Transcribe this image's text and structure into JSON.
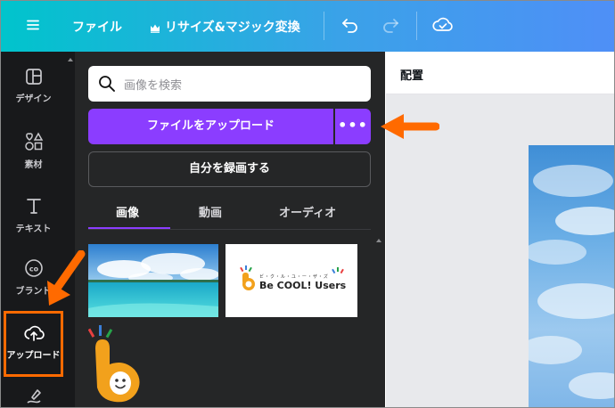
{
  "topbar": {
    "file_label": "ファイル",
    "resize_label": "リサイズ&マジック変換"
  },
  "rail": {
    "items": [
      {
        "label": "デザイン"
      },
      {
        "label": "素材"
      },
      {
        "label": "テキスト"
      },
      {
        "label": "ブランド"
      },
      {
        "label": "アップロード"
      }
    ]
  },
  "panel": {
    "search_placeholder": "画像を検索",
    "upload_label": "ファイルをアップロード",
    "more_label": "•••",
    "record_label": "自分を録画する",
    "tabs": [
      {
        "label": "画像",
        "active": true
      },
      {
        "label": "動画",
        "active": false
      },
      {
        "label": "オーディオ",
        "active": false
      }
    ],
    "thumb_logo": {
      "small_text": "ビ・ク・ル・ユ・ー・ザ・ズ",
      "main_text": "Be COOL! Users"
    }
  },
  "editor": {
    "position_label": "配置"
  },
  "colors": {
    "accent": "#8b3dff",
    "annotation": "#ff6a00"
  }
}
